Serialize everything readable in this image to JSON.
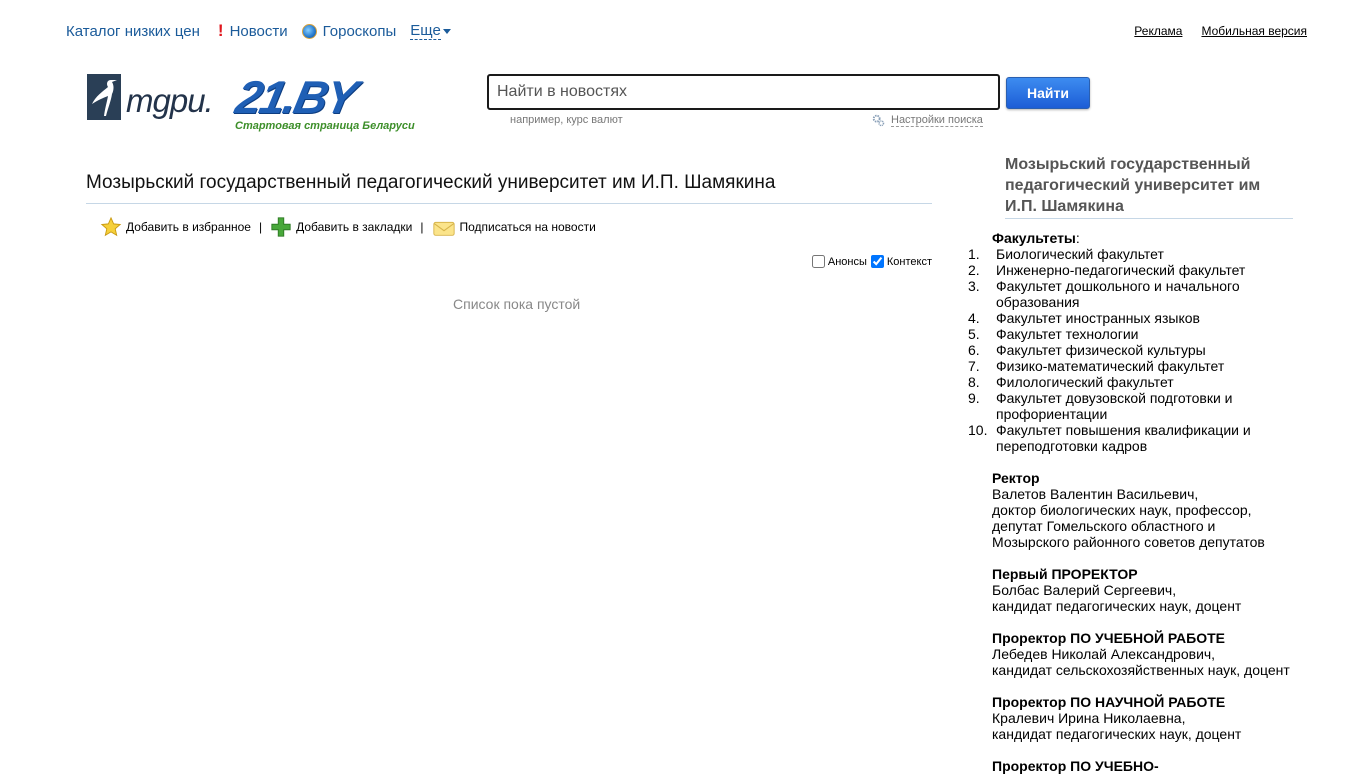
{
  "topnav": {
    "catalog": "Каталог низких цен",
    "news": "Новости",
    "horoscopes": "Гороскопы",
    "more": "Еще"
  },
  "toplinks": {
    "ads": "Реклама",
    "mobile": "Мобильная версия"
  },
  "logo": {
    "mgpu": "mgpu.",
    "site": "21.BY",
    "tagline": "Стартовая страница Беларуси"
  },
  "search": {
    "placeholder": "Найти в новостях",
    "button": "Найти",
    "example": "например, курс валют",
    "settings": "Настройки поиска"
  },
  "main": {
    "title": "Мозырьский государственный педагогический университет им И.П. Шамякина",
    "actions": {
      "favorite": "Добавить в избранное",
      "bookmark": "Добавить в закладки",
      "subscribe": "Подписаться на новости"
    },
    "filters": {
      "announcements": "Анонсы",
      "context": "Контекст"
    },
    "empty": "Список пока пустой"
  },
  "sidebar": {
    "title": "Мозырьский государственный педагогический университет им И.П. Шамякина",
    "faculties_head": "Факультеты",
    "faculties": [
      "Биологический факультет",
      "Инженерно-педагогический факультет",
      "Факультет дошкольного и начального образования",
      "Факультет иностранных языков",
      "Факультет технологии",
      "Факультет физической культуры",
      "Физико-математический факультет",
      "Филологический факультет",
      "Факультет довузовской подготовки и профориентации",
      "Факультет повышения квалификации и переподготовки кадров"
    ],
    "rector": {
      "head": "Ректор",
      "name": "Валетов Валентин Васильевич,",
      "line1": "доктор биологических наук, профессор,",
      "line2": "депутат Гомельского областного и",
      "line3": "Мозырского районного советов депутатов"
    },
    "first_prorector": {
      "head": "Первый ПРОРЕКТОР",
      "name": "Болбас Валерий Сергеевич,",
      "line1": "кандидат педагогических наук, доцент"
    },
    "prorector_edu": {
      "head": "Проректор ПО УЧЕБНОЙ РАБОТЕ",
      "name": "Лебедев Николай Александрович,",
      "line1": "кандидат сельскохозяйственных наук, доцент"
    },
    "prorector_sci": {
      "head": "Проректор ПО НАУЧНОЙ РАБОТЕ",
      "name": "Кралевич Ирина Николаевна,",
      "line1": "кандидат педагогических наук, доцент"
    },
    "prorector_next": {
      "head": "Проректор ПО УЧЕБНО-"
    }
  },
  "colors": {
    "link": "#1b5b9a",
    "button": "#1c5dd6",
    "tagline": "#3d8f2a"
  }
}
